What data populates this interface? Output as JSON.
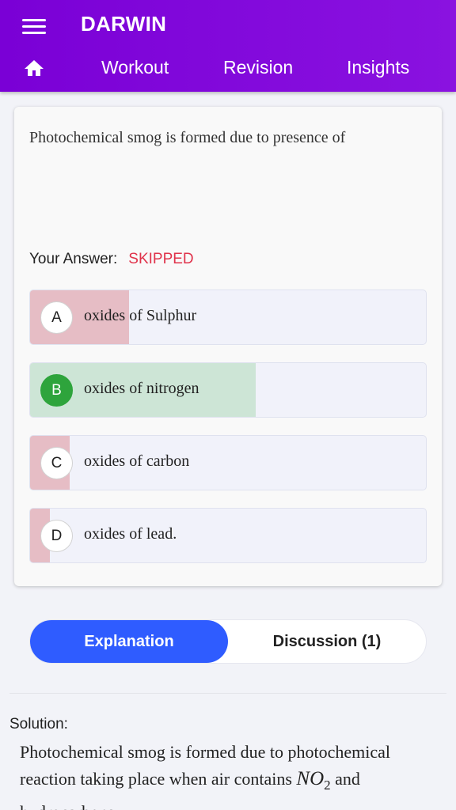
{
  "header": {
    "title": "DARWIN",
    "nav": {
      "home_icon": "home-icon",
      "workout": "Workout",
      "revision": "Revision",
      "insights": "Insights"
    }
  },
  "question": {
    "text": "Photochemical smog is formed due to presence of",
    "your_answer_label": "Your Answer:",
    "your_answer_value": "SKIPPED",
    "options": [
      {
        "letter": "A",
        "text": "oxides of Sulphur",
        "percent": 25,
        "status": "wrong"
      },
      {
        "letter": "B",
        "text": "oxides of nitrogen",
        "percent": 57,
        "status": "correct"
      },
      {
        "letter": "C",
        "text": "oxides of carbon",
        "percent": 10,
        "status": "wrong"
      },
      {
        "letter": "D",
        "text": "oxides of lead.",
        "percent": 5,
        "status": "wrong"
      }
    ]
  },
  "tabs": {
    "explanation": "Explanation",
    "discussion": "Discussion (1)"
  },
  "solution": {
    "label": "Solution:",
    "text_part1": "Photochemical smog is formed due to photochemical reaction taking place when air contains",
    "formula_base": "NO",
    "formula_sub": "2",
    "text_part2": "and hydrocarbons."
  },
  "colors": {
    "header": "#7a00d6",
    "accent": "#2f5cff",
    "wrong_fill": "#e6bdc5",
    "correct_fill": "#cde5d6",
    "correct_badge": "#2ea43c",
    "skipped": "#e0334b"
  }
}
